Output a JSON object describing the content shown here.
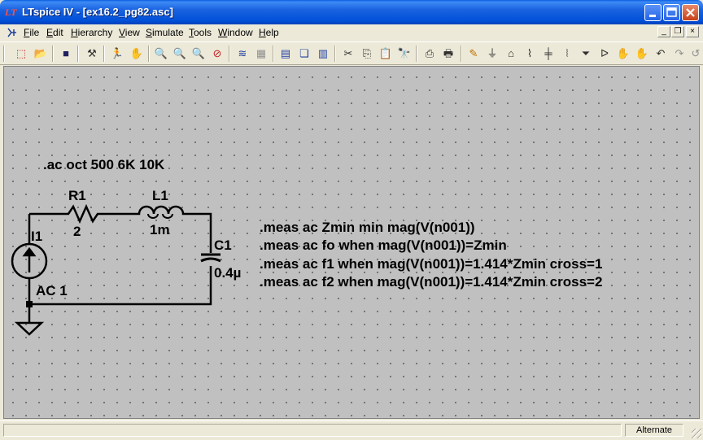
{
  "window": {
    "title": "LTspice IV - [ex16.2_pg82.asc]",
    "minimize_icon": "minimize-icon",
    "maximize_icon": "maximize-icon",
    "close_icon": "close-icon"
  },
  "menu": {
    "items": [
      {
        "underline": "F",
        "rest": "ile"
      },
      {
        "underline": "E",
        "rest": "dit"
      },
      {
        "underline": "H",
        "rest": "ierarchy"
      },
      {
        "underline": "V",
        "rest": "iew"
      },
      {
        "underline": "S",
        "rest": "imulate"
      },
      {
        "underline": "T",
        "rest": "ools"
      },
      {
        "underline": "W",
        "rest": "indow"
      },
      {
        "underline": "H",
        "rest": "elp"
      }
    ]
  },
  "toolbar": {
    "icons": [
      "new-schematic-icon",
      "open-icon",
      "save-icon",
      "control-panel-icon",
      "run-icon",
      "halt-icon",
      "zoom-in-icon",
      "zoom-pan-icon",
      "zoom-out-icon",
      "zoom-cancel-icon",
      "autorange-icon",
      "grid-icon",
      "tile-horizontal-icon",
      "cascade-icon",
      "tile-vertical-icon",
      "cut-icon",
      "copy-icon",
      "paste-icon",
      "find-icon",
      "print-setup-icon",
      "print-icon",
      "wire-icon",
      "ground-icon",
      "label-icon",
      "resistor-icon",
      "capacitor-icon",
      "inductor-icon",
      "diode-icon",
      "component-icon",
      "move-icon",
      "drag-icon",
      "undo-icon",
      "redo-icon",
      "rotate-icon"
    ]
  },
  "schematic": {
    "directive": ".ac oct 500 6K 10K",
    "components": {
      "r1_name": "R1",
      "r1_value": "2",
      "l1_name": "L1",
      "l1_value": "1m",
      "c1_name": "C1",
      "c1_value": "0.4µ",
      "i1_name": "I1",
      "i1_value": "AC 1"
    },
    "meas": [
      ".meas ac Zmin min mag(V(n001))",
      ".meas ac fo when mag(V(n001))=Zmin",
      ".meas ac f1 when mag(V(n001))=1.414*Zmin cross=1",
      ".meas ac f2 when mag(V(n001))=1.414*Zmin cross=2"
    ]
  },
  "status": {
    "mode": "Alternate"
  }
}
